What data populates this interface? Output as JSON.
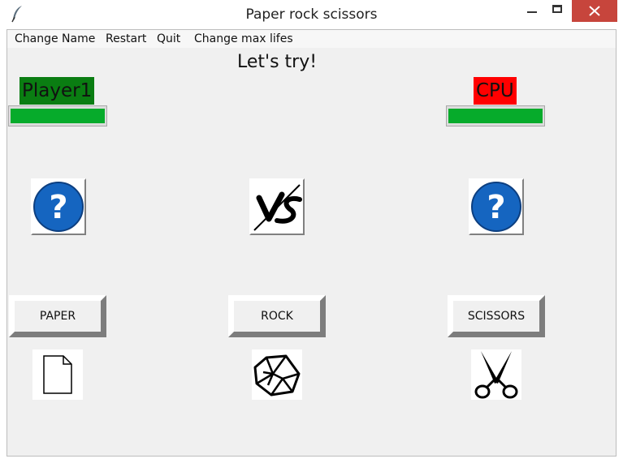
{
  "window": {
    "title": "Paper rock scissors"
  },
  "menu": [
    "Change Name",
    "Restart",
    "Quit",
    "Change max lifes"
  ],
  "heading": "Let's try!",
  "player": {
    "name": "Player1",
    "name_bg": "#0a7d12",
    "life_fraction": 1.0
  },
  "cpu": {
    "name": "CPU",
    "name_bg": "#ff0000",
    "life_fraction": 1.0
  },
  "slots": {
    "player_choice_icon": "question-icon",
    "versus_icon": "vs-icon",
    "cpu_choice_icon": "question-icon"
  },
  "buttons": {
    "paper": "PAPER",
    "rock": "ROCK",
    "scissors": "SCISSORS"
  },
  "colors": {
    "life_green": "#06ab2b",
    "close_red": "#c7453c",
    "question_blue": "#1565c0"
  }
}
